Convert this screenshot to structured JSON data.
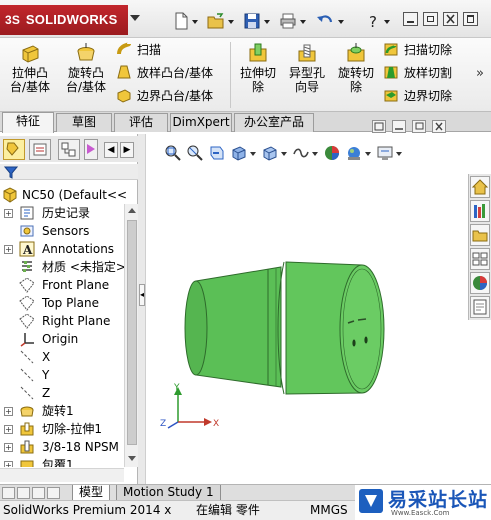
{
  "app": {
    "logo_text": "SOLIDWORKS",
    "logo_ds": "3S"
  },
  "ribbon": {
    "big_buttons": [
      {
        "label_line1": "拉伸凸",
        "label_line2": "台/基体",
        "icon": "extruded-boss-icon"
      },
      {
        "label_line1": "旋转凸",
        "label_line2": "台/基体",
        "icon": "revolved-boss-icon"
      },
      {
        "label_line1": "拉伸切",
        "label_line2": "除",
        "icon": "extruded-cut-icon"
      },
      {
        "label_line1": "异型孔",
        "label_line2": "向导",
        "icon": "hole-wizard-icon"
      },
      {
        "label_line1": "旋转切",
        "label_line2": "除",
        "icon": "revolved-cut-icon"
      }
    ],
    "small_buttons_left": [
      {
        "label": "扫描",
        "icon": "sweep-icon"
      },
      {
        "label": "放样凸台/基体",
        "icon": "lofted-boss-icon"
      },
      {
        "label": "边界凸台/基体",
        "icon": "boundary-boss-icon"
      }
    ],
    "small_buttons_right": [
      {
        "label": "扫描切除",
        "icon": "swept-cut-icon"
      },
      {
        "label": "放样切割",
        "icon": "lofted-cut-icon"
      },
      {
        "label": "边界切除",
        "icon": "boundary-cut-icon"
      }
    ],
    "more_label": "»"
  },
  "tabs": [
    {
      "label": "特征",
      "active": true
    },
    {
      "label": "草图",
      "active": false
    },
    {
      "label": "评估",
      "active": false
    },
    {
      "label": "DimXpert",
      "active": false
    },
    {
      "label": "办公室产品",
      "active": false
    }
  ],
  "feature_tree": {
    "root": "NC50  (Default<<",
    "items": [
      {
        "label": "历史记录",
        "icon": "history-folder-icon",
        "expand": "+"
      },
      {
        "label": "Sensors",
        "icon": "sensors-icon",
        "expand": ""
      },
      {
        "label": "Annotations",
        "icon": "annotations-icon",
        "expand": "+"
      },
      {
        "label": "材质 <未指定>",
        "icon": "material-icon",
        "expand": ""
      },
      {
        "label": "Front Plane",
        "icon": "plane-icon",
        "expand": ""
      },
      {
        "label": "Top Plane",
        "icon": "plane-icon",
        "expand": ""
      },
      {
        "label": "Right Plane",
        "icon": "plane-icon",
        "expand": ""
      },
      {
        "label": "Origin",
        "icon": "origin-icon",
        "expand": ""
      },
      {
        "label": "X",
        "icon": "axis-icon",
        "expand": ""
      },
      {
        "label": "Y",
        "icon": "axis-icon",
        "expand": ""
      },
      {
        "label": "Z",
        "icon": "axis-icon",
        "expand": ""
      },
      {
        "label": "旋转1",
        "icon": "revolve-feature-icon",
        "expand": "+"
      },
      {
        "label": "切除-拉伸1",
        "icon": "cut-extrude-feature-icon",
        "expand": "+"
      },
      {
        "label": "3/8-18 NPSM",
        "icon": "hole-feature-icon",
        "expand": "+"
      },
      {
        "label": "包覆1",
        "icon": "wrap-feature-icon",
        "expand": "+"
      }
    ]
  },
  "filter_icon": "filter-icon",
  "viewport": {
    "triad": {
      "x": "X",
      "y": "Y",
      "z": "Z"
    }
  },
  "bottom_tabs": [
    {
      "label": "模型",
      "active": true
    },
    {
      "label": "Motion Study 1",
      "active": false
    }
  ],
  "status": {
    "product": "SolidWorks Premium 2014 x",
    "editing": "在编辑 零件",
    "units": "MMGS"
  },
  "watermark": {
    "text": "易采站长站",
    "url": "Www.Easck.Com"
  },
  "colors": {
    "part_green": "#5dbf5a",
    "logo_red": "#b22128"
  }
}
